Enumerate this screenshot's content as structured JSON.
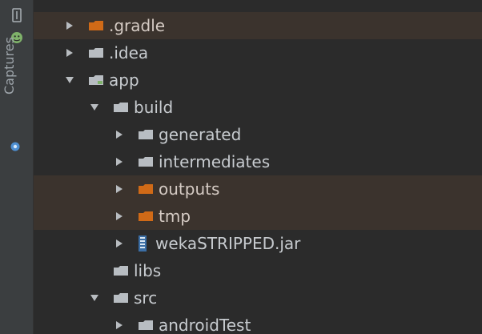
{
  "sidebar": {
    "captures_label": "Captures",
    "icons": {
      "top": "window-icon",
      "droid": "android-icon",
      "captures": "camera-icon"
    }
  },
  "tree": [
    {
      "label": ".gradle",
      "level": 0,
      "caret": "collapsed",
      "type": "folder-orange",
      "excluded": true
    },
    {
      "label": ".idea",
      "level": 0,
      "caret": "collapsed",
      "type": "folder-gray",
      "excluded": false
    },
    {
      "label": "app",
      "level": 0,
      "caret": "expanded",
      "type": "module",
      "excluded": false
    },
    {
      "label": "build",
      "level": 1,
      "caret": "expanded",
      "type": "folder-gray",
      "excluded": false
    },
    {
      "label": "generated",
      "level": 2,
      "caret": "collapsed",
      "type": "folder-gray",
      "excluded": false
    },
    {
      "label": "intermediates",
      "level": 2,
      "caret": "collapsed",
      "type": "folder-gray",
      "excluded": false
    },
    {
      "label": "outputs",
      "level": 2,
      "caret": "collapsed",
      "type": "folder-orange",
      "excluded": true
    },
    {
      "label": "tmp",
      "level": 2,
      "caret": "collapsed",
      "type": "folder-orange",
      "excluded": true
    },
    {
      "label": "wekaSTRIPPED.jar",
      "level": 2,
      "caret": "collapsed",
      "type": "jar",
      "excluded": false
    },
    {
      "label": "libs",
      "level": 1,
      "caret": "none",
      "type": "folder-gray",
      "excluded": false
    },
    {
      "label": "src",
      "level": 1,
      "caret": "expanded",
      "type": "folder-gray",
      "excluded": false
    },
    {
      "label": "androidTest",
      "level": 2,
      "caret": "collapsed",
      "type": "folder-gray",
      "excluded": false
    }
  ],
  "colors": {
    "background": "#2b2b2b",
    "sidebar": "#3b3e40",
    "excluded_row": "#3b332d",
    "text": "#c7cbcf",
    "orange_folder": "#d06a17",
    "gray_folder": "#b8bdc2",
    "jar_blue": "#3b6ea5",
    "module_green": "#7fb26a"
  }
}
